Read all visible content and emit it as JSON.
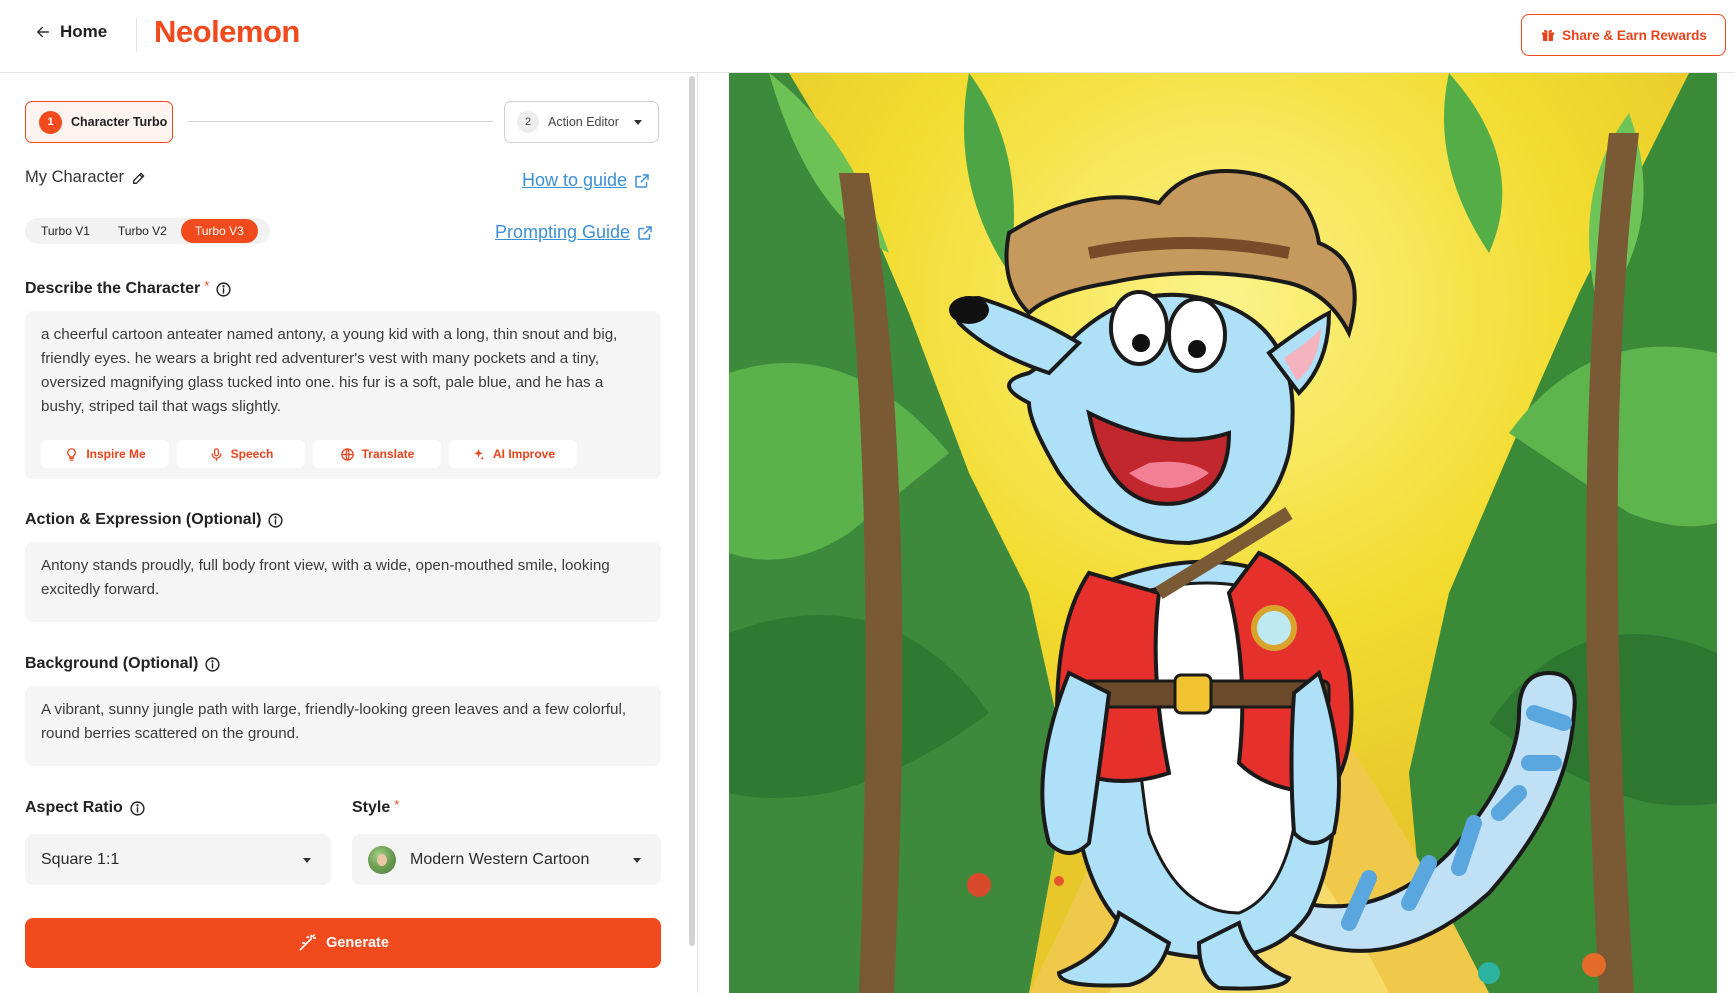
{
  "header": {
    "home_label": "Home",
    "brand": "Neolemon",
    "share_label": "Share & Earn Rewards"
  },
  "steps": [
    {
      "number": "1",
      "label": "Character Turbo",
      "active": true
    },
    {
      "number": "2",
      "label": "Action Editor",
      "active": false
    }
  ],
  "character": {
    "name_label": "My Character",
    "how_to_guide": "How to guide",
    "prompting_guide": "Prompting Guide"
  },
  "turbo_versions": [
    {
      "label": "Turbo V1",
      "selected": false
    },
    {
      "label": "Turbo V2",
      "selected": false
    },
    {
      "label": "Turbo V3",
      "selected": true
    }
  ],
  "describe": {
    "label": "Describe the Character",
    "required_mark": "*",
    "value": "a cheerful cartoon anteater named antony, a young kid with a long, thin snout and big, friendly eyes. he wears a bright red adventurer's vest with many pockets and a tiny, oversized magnifying glass tucked into one. his fur is a soft, pale blue, and he has a bushy, striped tail that wags slightly."
  },
  "tools": [
    {
      "label": "Inspire Me",
      "icon": "lightbulb-icon"
    },
    {
      "label": "Speech",
      "icon": "microphone-icon"
    },
    {
      "label": "Translate",
      "icon": "globe-icon"
    },
    {
      "label": "AI Improve",
      "icon": "sparkles-icon"
    }
  ],
  "action": {
    "label": "Action & Expression (Optional)",
    "value": "Antony stands proudly, full body front view, with a wide, open-mouthed smile, looking excitedly forward."
  },
  "background": {
    "label": "Background (Optional)",
    "value": "A vibrant, sunny jungle path with large, friendly-looking green leaves and a few colorful, round berries scattered on the ground."
  },
  "aspect_ratio": {
    "label": "Aspect Ratio",
    "value": "Square 1:1"
  },
  "style": {
    "label": "Style",
    "required_mark": "*",
    "value": "Modern Western Cartoon"
  },
  "generate_label": "Generate",
  "colors": {
    "accent": "#f04a1d",
    "link": "#3d8fd6",
    "field_bg": "#f5f5f5"
  }
}
